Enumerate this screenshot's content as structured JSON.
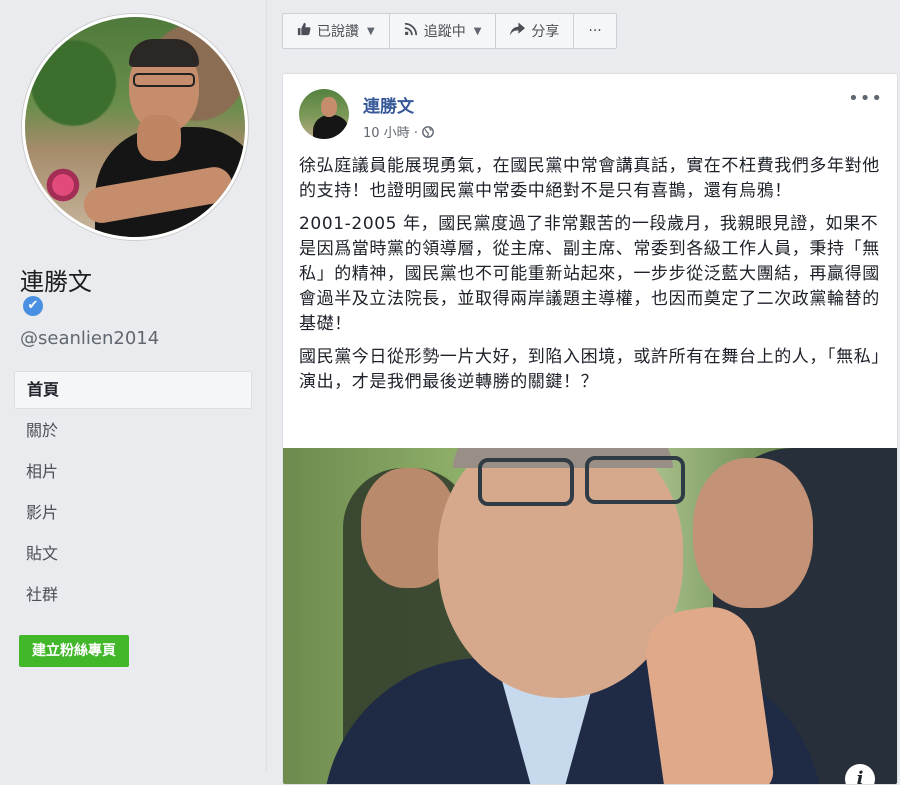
{
  "profile": {
    "name": "連勝文",
    "verified_icon": "✔",
    "handle": "@seanlien2014"
  },
  "nav": {
    "items": [
      "首頁",
      "關於",
      "相片",
      "影片",
      "貼文",
      "社群"
    ],
    "active_index": 0,
    "create_page_label": "建立粉絲專頁"
  },
  "action_bar": {
    "liked_label": "已說讚",
    "following_label": "追蹤中",
    "share_label": "分享",
    "more_label": "···"
  },
  "post": {
    "author": "連勝文",
    "time": "10 小時",
    "separator": "·",
    "privacy_icon": "globe-icon",
    "menu_label": "•••",
    "paragraphs": [
      "徐弘庭議員能展現勇氣，在國民黨中常會講真話，實在不枉費我們多年對他的支持！也證明國民黨中常委中絕對不是只有喜鵲，還有烏鴉！",
      "2001-2005 年，國民黨度過了非常艱苦的一段歲月，我親眼見證，如果不是因爲當時黨的領導層，從主席、副主席、常委到各級工作人員，秉持「無私」的精神，國民黨也不可能重新站起來，一步步從泛藍大團結，再贏得國會過半及立法院長，並取得兩岸議題主導權，也因而奠定了二次政黨輪替的基礎！",
      "國民黨今日從形勢一片大好，到陷入困境，或許所有在舞台上的人，「無私」演出，才是我們最後逆轉勝的關鍵！？"
    ],
    "photo_info_label": "i"
  },
  "colors": {
    "page_bg": "#e9ebee",
    "link": "#365899",
    "green_button": "#42b72a",
    "verified": "#4a90e2"
  }
}
